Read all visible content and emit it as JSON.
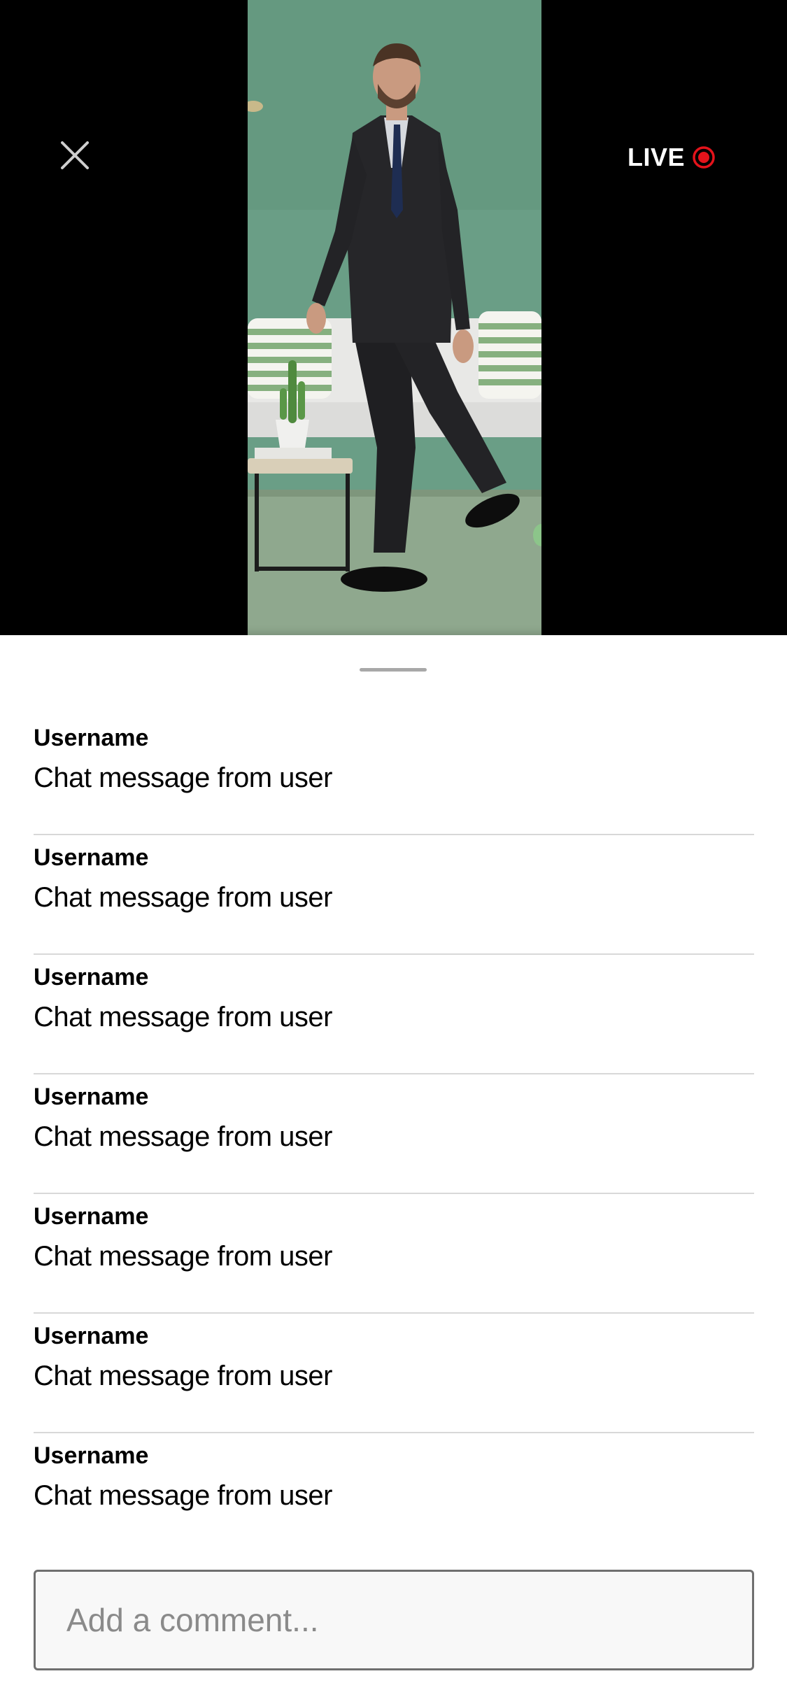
{
  "player": {
    "close_icon": "close-icon",
    "live_label": "LIVE",
    "live_indicator_color": "#e4131b"
  },
  "chat": {
    "messages": [
      {
        "username": "Username",
        "text": "Chat message from user"
      },
      {
        "username": "Username",
        "text": "Chat message from user"
      },
      {
        "username": "Username",
        "text": "Chat message from user"
      },
      {
        "username": "Username",
        "text": "Chat message from user"
      },
      {
        "username": "Username",
        "text": "Chat message from user"
      },
      {
        "username": "Username",
        "text": "Chat message from user"
      },
      {
        "username": "Username",
        "text": "Chat message from user"
      }
    ],
    "comment_placeholder": "Add a comment..."
  }
}
